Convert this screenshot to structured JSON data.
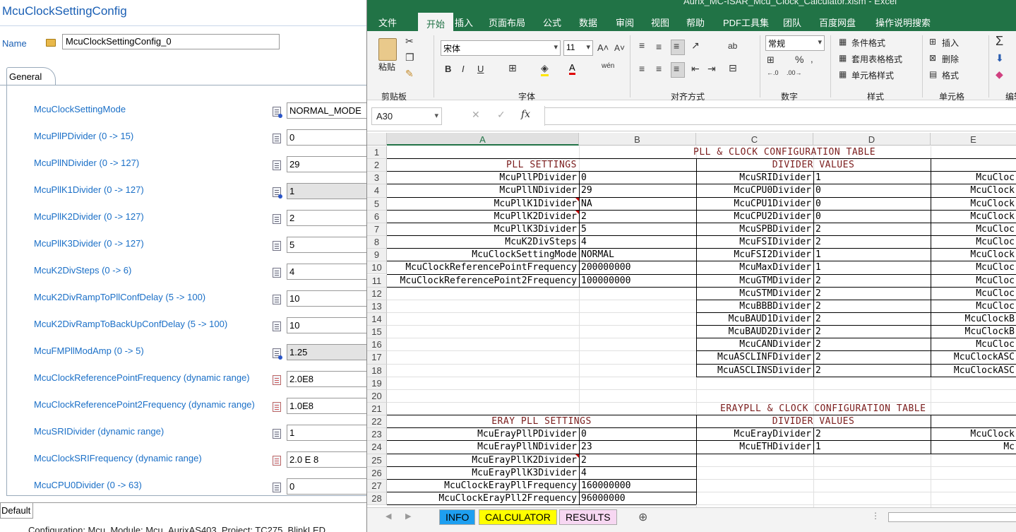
{
  "left_panel": {
    "title": "McuClockSettingConfig",
    "name_label": "Name",
    "name_value": "McuClockSettingConfig_0",
    "tab_general": "General",
    "tab_default": "Default",
    "status_text": "Configuration: Mcu, Module: Mcu_AurixAS403, Project: TC275_BlinkLED",
    "params": [
      {
        "label": "McuClockSettingMode",
        "value": "NORMAL_MODE",
        "icon": "enum-param-icon",
        "gray": false
      },
      {
        "label": "McuPllPDivider (0 -> 15)",
        "value": "0",
        "icon": "int-param-icon",
        "gray": false
      },
      {
        "label": "McuPllNDivider (0 -> 127)",
        "value": "29",
        "icon": "int-param-icon",
        "gray": false
      },
      {
        "label": "McuPllK1Divider (0 -> 127)",
        "value": "1",
        "icon": "int-param-icon",
        "gray": true
      },
      {
        "label": "McuPllK2Divider (0 -> 127)",
        "value": "2",
        "icon": "int-param-icon",
        "gray": false
      },
      {
        "label": "McuPllK3Divider (0 -> 127)",
        "value": "5",
        "icon": "int-param-icon",
        "gray": false
      },
      {
        "label": "McuK2DivSteps (0 -> 6)",
        "value": "4",
        "icon": "int-param-icon",
        "gray": false
      },
      {
        "label": "McuK2DivRampToPllConfDelay (5 -> 100)",
        "value": "10",
        "icon": "int-param-icon",
        "gray": false
      },
      {
        "label": "McuK2DivRampToBackUpConfDelay (5 -> 100)",
        "value": "10",
        "icon": "int-param-icon",
        "gray": false
      },
      {
        "label": "McuFMPllModAmp (0 -> 5)",
        "value": "1.25",
        "icon": "float-param-icon",
        "gray": true
      },
      {
        "label": "McuClockReferencePointFrequency (dynamic range)",
        "value": "2.0E8",
        "icon": "float-param-icon",
        "gray": false
      },
      {
        "label": "McuClockReferencePoint2Frequency (dynamic range)",
        "value": "1.0E8",
        "icon": "float-param-icon",
        "gray": false
      },
      {
        "label": "McuSRIDivider (dynamic range)",
        "value": "1",
        "icon": "int-param-icon",
        "gray": false
      },
      {
        "label": "McuClockSRIFrequency (dynamic range)",
        "value": "2.0 E 8",
        "icon": "float-param-icon",
        "gray": false
      },
      {
        "label": "McuCPU0Divider (0 -> 63)",
        "value": "0",
        "icon": "int-param-icon",
        "gray": false
      }
    ]
  },
  "excel": {
    "title": "Aurix_MC-ISAR_Mcu_Clock_Calculator.xlsm - Excel",
    "menu": [
      "文件",
      "开始",
      "插入",
      "页面布局",
      "公式",
      "数据",
      "审阅",
      "视图",
      "帮助",
      "PDF工具集",
      "团队",
      "百度网盘",
      "操作说明搜索"
    ],
    "ribbon": {
      "paste": "粘贴",
      "clipboard": "剪贴板",
      "font_name": "宋体",
      "font_size": "11",
      "font_group": "字体",
      "align_group": "对齐方式",
      "number_format": "常规",
      "number_group": "数字",
      "cond_format": "条件格式",
      "table_format": "套用表格格式",
      "cell_style": "单元格样式",
      "style_group": "样式",
      "insert": "插入",
      "delete": "删除",
      "format": "格式",
      "cells_group": "单元格",
      "edit_group": "编辑"
    },
    "name_box": "A30",
    "columns": [
      "A",
      "B",
      "C",
      "D",
      "E"
    ],
    "rows": [
      "1",
      "2",
      "3",
      "4",
      "5",
      "6",
      "7",
      "8",
      "9",
      "10",
      "11",
      "12",
      "13",
      "14",
      "15",
      "16",
      "17",
      "18",
      "19",
      "20",
      "21",
      "22",
      "23",
      "24",
      "25",
      "26",
      "27",
      "28"
    ],
    "title1": "PLL & CLOCK CONFIGURATION TABLE",
    "pll_header": "PLL SETTINGS",
    "div_header": "DIVIDER VALUES",
    "pll_settings": [
      {
        "name": "McuPllPDivider",
        "value": "0"
      },
      {
        "name": "McuPllNDivider",
        "value": "29"
      },
      {
        "name": "McuPllK1Divider",
        "value": "NA"
      },
      {
        "name": "McuPllK2Divider",
        "value": "2"
      },
      {
        "name": "McuPllK3Divider",
        "value": "5"
      },
      {
        "name": "McuK2DivSteps",
        "value": "4"
      },
      {
        "name": "McuClockSettingMode",
        "value": "NORMAL"
      },
      {
        "name": "McuClockReferencePointFrequency",
        "value": "200000000"
      },
      {
        "name": "McuClockReferencePoint2Frequency",
        "value": "100000000"
      }
    ],
    "dividers": [
      {
        "name": "McuSRIDivider",
        "value": "1",
        "e": "McuCloc"
      },
      {
        "name": "McuCPU0Divider",
        "value": "0",
        "e": "McuClock"
      },
      {
        "name": "McuCPU1Divider",
        "value": "0",
        "e": "McuClock"
      },
      {
        "name": "McuCPU2Divider",
        "value": "0",
        "e": "McuClock"
      },
      {
        "name": "McuSPBDivider",
        "value": "2",
        "e": "McuCloc"
      },
      {
        "name": "McuFSIDivider",
        "value": "2",
        "e": "McuCloc"
      },
      {
        "name": "McuFSI2Divider",
        "value": "1",
        "e": "McuClock"
      },
      {
        "name": "McuMaxDivider",
        "value": "1",
        "e": "McuCloc"
      },
      {
        "name": "McuGTMDivider",
        "value": "2",
        "e": "McuCloc"
      },
      {
        "name": "McuSTMDivider",
        "value": "2",
        "e": "McuCloc"
      },
      {
        "name": "McuBBBDivider",
        "value": "2",
        "e": "McuCloc"
      },
      {
        "name": "McuBAUD1Divider",
        "value": "2",
        "e": "McuClockB"
      },
      {
        "name": "McuBAUD2Divider",
        "value": "2",
        "e": "McuClockB"
      },
      {
        "name": "McuCANDivider",
        "value": "2",
        "e": "McuCloc"
      },
      {
        "name": "McuASCLINFDivider",
        "value": "2",
        "e": "McuClockASC"
      },
      {
        "name": "McuASCLINSDivider",
        "value": "2",
        "e": "McuClockASC"
      }
    ],
    "title2": "ERAYPLL & CLOCK CONFIGURATION TABLE",
    "eray_header": "ERAY PLL SETTINGS",
    "div_header2": "DIVIDER VALUES",
    "eray_settings": [
      {
        "name": "McuErayPllPDivider",
        "value": "0"
      },
      {
        "name": "McuErayPllNDivider",
        "value": "23"
      },
      {
        "name": "McuErayPllK2Divider",
        "value": "2"
      },
      {
        "name": "McuErayPllK3Divider",
        "value": "4"
      },
      {
        "name": "McuClockErayPllFrequency",
        "value": "160000000"
      },
      {
        "name": "McuClockErayPll2Frequency",
        "value": "96000000"
      }
    ],
    "eray_dividers": [
      {
        "name": "McuErayDivider",
        "value": "2",
        "e": "McuClock"
      },
      {
        "name": "McuETHDivider",
        "value": "1",
        "e": "Mc"
      }
    ],
    "sheets": [
      "INFO",
      "CALCULATOR",
      "RESULTS"
    ]
  }
}
